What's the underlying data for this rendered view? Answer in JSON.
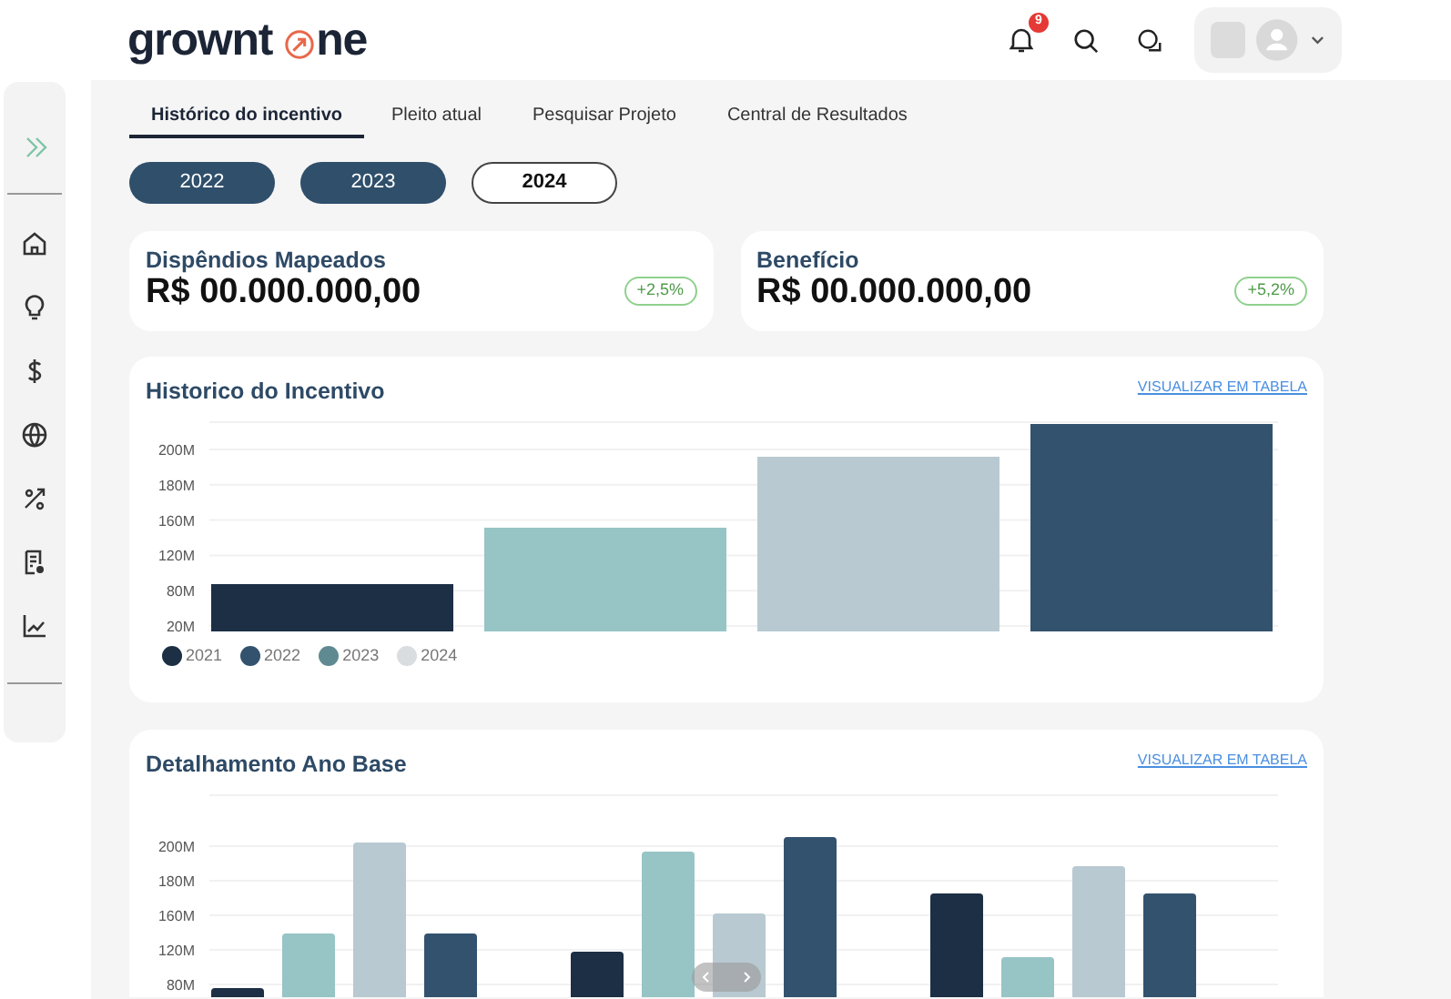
{
  "header": {
    "logo_left": "grownt",
    "logo_right": "ne",
    "notifications": "9"
  },
  "sidebar": {
    "items": [
      {
        "selected": true
      },
      {
        "selected": false
      },
      {
        "selected": false
      },
      {
        "selected": false
      },
      {
        "selected": false
      },
      {
        "selected": false
      },
      {
        "selected": false
      },
      {
        "selected": false
      }
    ]
  },
  "tabs": [
    {
      "label": "Histórico do incentivo",
      "selected": true
    },
    {
      "label": "Pleito atual",
      "selected": false
    },
    {
      "label": "Pesquisar Projeto",
      "selected": false
    },
    {
      "label": "Central de Resultados",
      "selected": false
    }
  ],
  "year_filters": [
    {
      "label": "2022",
      "selected": true
    },
    {
      "label": "2023",
      "selected": true
    },
    {
      "label": "2024",
      "selected": false
    }
  ],
  "kpis": [
    {
      "title": "Dispêndios Mapeados",
      "value": "R$ 00.000.000,00",
      "change": "+2,5%"
    },
    {
      "title": "Benefício",
      "value": "R$ 00.000.000,00",
      "change": "+5,2%"
    }
  ],
  "charts": [
    {
      "title": "Historico do Incentivo",
      "link": "VISUALIZAR EM TABELA",
      "y_axis_labels": [
        "200M",
        "180M",
        "160M",
        "120M",
        "80M",
        "20M"
      ],
      "legend": [
        {
          "label": "2021",
          "color": "#1c2f45"
        },
        {
          "label": "2022",
          "color": "#33526e"
        },
        {
          "label": "2023",
          "color": "#5f8a92"
        },
        {
          "label": "2024",
          "color": "#d9dddf"
        }
      ]
    },
    {
      "title": "Detalhamento Ano Base",
      "link": "VISUALIZAR EM TABELA",
      "y_axis_labels": [
        "200M",
        "180M",
        "160M",
        "120M",
        "80M"
      ]
    }
  ]
}
